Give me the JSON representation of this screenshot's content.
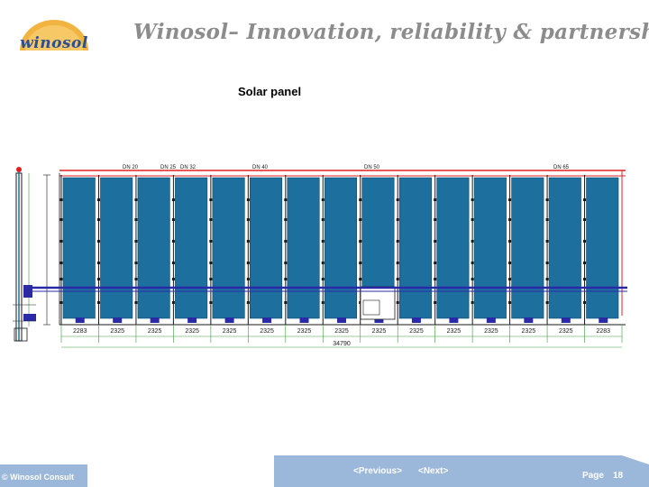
{
  "header": {
    "logo_text": "winosol",
    "tagline": "Winosol– Innovation, reliability & partnership",
    "colors": {
      "sun": "#f2b441",
      "logo_text": "#2d4e8f",
      "tagline": "#8c8c8c"
    }
  },
  "slide": {
    "title": "Solar panel"
  },
  "diagram": {
    "pipe_labels": [
      "DN 20",
      "DN 25",
      "DN 32",
      "DN 40",
      "DN 50",
      "DN 65"
    ],
    "panel_widths": [
      "2283",
      "2325",
      "2325",
      "2325",
      "2325",
      "2325",
      "2325",
      "2325",
      "2325",
      "2325",
      "2325",
      "2325",
      "2325",
      "2325",
      "2283"
    ],
    "total_width": "34790",
    "colors": {
      "panel": "#1d6f9e",
      "pipe_red": "#e02020",
      "pipe_blue": "#2a2aa8",
      "frame": "#1a1a1a",
      "dim_green": "#3a9a3a"
    }
  },
  "footer": {
    "copyright": "© Winosol Consult",
    "prev_label": "<Previous>",
    "next_label": "<Next>",
    "page_label": "Page",
    "page_number": "18",
    "colors": {
      "bar": "#9bb7d9"
    }
  }
}
